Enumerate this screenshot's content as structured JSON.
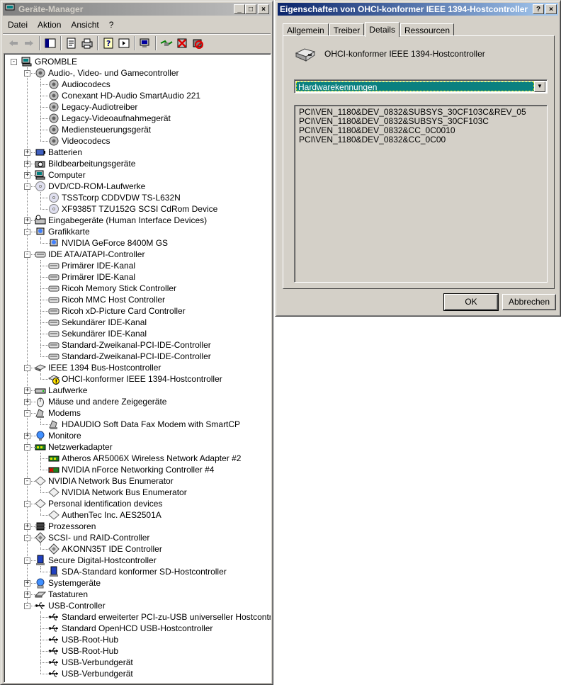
{
  "device_manager": {
    "title": "Geräte-Manager",
    "menu": [
      "Datei",
      "Aktion",
      "Ansicht",
      "?"
    ],
    "toolbar_icons": [
      "back-arrow-icon",
      "forward-arrow-icon",
      "console-tree-icon",
      "properties-icon",
      "print-icon",
      "help-icon",
      "view-icon",
      "scan-hardware-icon",
      "update-driver-icon",
      "uninstall-icon",
      "disable-icon"
    ],
    "tree": [
      {
        "label": "GROMBLE",
        "level": 0,
        "icon": "computer-icon",
        "exp": "-"
      },
      {
        "label": "Audio-, Video- und Gamecontroller",
        "level": 1,
        "icon": "audio-icon",
        "exp": "-"
      },
      {
        "label": "Audiocodecs",
        "level": 2,
        "icon": "audio-icon"
      },
      {
        "label": "Conexant HD-Audio SmartAudio 221",
        "level": 2,
        "icon": "audio-icon"
      },
      {
        "label": "Legacy-Audiotreiber",
        "level": 2,
        "icon": "audio-icon"
      },
      {
        "label": "Legacy-Videoaufnahmegerät",
        "level": 2,
        "icon": "audio-icon"
      },
      {
        "label": "Mediensteuerungsgerät",
        "level": 2,
        "icon": "audio-icon"
      },
      {
        "label": "Videocodecs",
        "level": 2,
        "icon": "audio-icon"
      },
      {
        "label": "Batterien",
        "level": 1,
        "icon": "battery-icon",
        "exp": "+"
      },
      {
        "label": "Bildbearbeitungsgeräte",
        "level": 1,
        "icon": "camera-icon",
        "exp": "+"
      },
      {
        "label": "Computer",
        "level": 1,
        "icon": "computer-icon",
        "exp": "+"
      },
      {
        "label": "DVD/CD-ROM-Laufwerke",
        "level": 1,
        "icon": "cd-icon",
        "exp": "-"
      },
      {
        "label": "TSSTcorp CDDVDW TS-L632N",
        "level": 2,
        "icon": "cd-icon"
      },
      {
        "label": "XF9385T TZU152G SCSI CdRom Device",
        "level": 2,
        "icon": "cd-icon"
      },
      {
        "label": "Eingabegeräte (Human Interface Devices)",
        "level": 1,
        "icon": "hid-icon",
        "exp": "+"
      },
      {
        "label": "Grafikkarte",
        "level": 1,
        "icon": "display-icon",
        "exp": "-"
      },
      {
        "label": "NVIDIA GeForce 8400M GS",
        "level": 2,
        "icon": "display-icon"
      },
      {
        "label": "IDE ATA/ATAPI-Controller",
        "level": 1,
        "icon": "ide-icon",
        "exp": "-"
      },
      {
        "label": "Primärer IDE-Kanal",
        "level": 2,
        "icon": "ide-icon"
      },
      {
        "label": "Primärer IDE-Kanal",
        "level": 2,
        "icon": "ide-icon"
      },
      {
        "label": "Ricoh Memory Stick Controller",
        "level": 2,
        "icon": "ide-icon"
      },
      {
        "label": "Ricoh MMC Host Controller",
        "level": 2,
        "icon": "ide-icon"
      },
      {
        "label": "Ricoh xD-Picture Card Controller",
        "level": 2,
        "icon": "ide-icon"
      },
      {
        "label": "Sekundärer IDE-Kanal",
        "level": 2,
        "icon": "ide-icon"
      },
      {
        "label": "Sekundärer IDE-Kanal",
        "level": 2,
        "icon": "ide-icon"
      },
      {
        "label": "Standard-Zweikanal-PCI-IDE-Controller",
        "level": 2,
        "icon": "ide-icon"
      },
      {
        "label": "Standard-Zweikanal-PCI-IDE-Controller",
        "level": 2,
        "icon": "ide-icon"
      },
      {
        "label": "IEEE 1394 Bus-Hostcontroller",
        "level": 1,
        "icon": "firewire-icon",
        "exp": "-"
      },
      {
        "label": "OHCI-konformer IEEE 1394-Hostcontroller",
        "level": 2,
        "icon": "warning-device-icon"
      },
      {
        "label": "Laufwerke",
        "level": 1,
        "icon": "drive-icon",
        "exp": "+"
      },
      {
        "label": "Mäuse und andere Zeigegeräte",
        "level": 1,
        "icon": "mouse-icon",
        "exp": "+"
      },
      {
        "label": "Modems",
        "level": 1,
        "icon": "modem-icon",
        "exp": "-"
      },
      {
        "label": "HDAUDIO Soft Data Fax Modem with SmartCP",
        "level": 2,
        "icon": "modem-icon"
      },
      {
        "label": "Monitore",
        "level": 1,
        "icon": "monitor-icon",
        "exp": "+"
      },
      {
        "label": "Netzwerkadapter",
        "level": 1,
        "icon": "network-icon",
        "exp": "-"
      },
      {
        "label": "Atheros AR5006X Wireless Network Adapter #2",
        "level": 2,
        "icon": "network-icon"
      },
      {
        "label": "NVIDIA nForce Networking Controller #4",
        "level": 2,
        "icon": "network-disabled-icon"
      },
      {
        "label": "NVIDIA Network Bus Enumerator",
        "level": 1,
        "icon": "diamond-icon",
        "exp": "-"
      },
      {
        "label": "NVIDIA Network Bus Enumerator",
        "level": 2,
        "icon": "diamond-icon"
      },
      {
        "label": "Personal identification devices",
        "level": 1,
        "icon": "diamond-icon",
        "exp": "-"
      },
      {
        "label": "AuthenTec Inc. AES2501A",
        "level": 2,
        "icon": "diamond-icon"
      },
      {
        "label": "Prozessoren",
        "level": 1,
        "icon": "cpu-icon",
        "exp": "+"
      },
      {
        "label": "SCSI- und RAID-Controller",
        "level": 1,
        "icon": "scsi-icon",
        "exp": "-"
      },
      {
        "label": "AKONN35T IDE Controller",
        "level": 2,
        "icon": "scsi-icon"
      },
      {
        "label": "Secure Digital-Hostcontroller",
        "level": 1,
        "icon": "sd-icon",
        "exp": "-"
      },
      {
        "label": "SDA-Standard konformer SD-Hostcontroller",
        "level": 2,
        "icon": "sd-icon"
      },
      {
        "label": "Systemgeräte",
        "level": 1,
        "icon": "system-icon",
        "exp": "+"
      },
      {
        "label": "Tastaturen",
        "level": 1,
        "icon": "keyboard-icon",
        "exp": "+"
      },
      {
        "label": "USB-Controller",
        "level": 1,
        "icon": "usb-icon",
        "exp": "-"
      },
      {
        "label": "Standard erweiterter PCI-zu-USB universeller Hostcontroller",
        "level": 2,
        "icon": "usb-icon"
      },
      {
        "label": "Standard OpenHCD USB-Hostcontroller",
        "level": 2,
        "icon": "usb-icon"
      },
      {
        "label": "USB-Root-Hub",
        "level": 2,
        "icon": "usb-icon"
      },
      {
        "label": "USB-Root-Hub",
        "level": 2,
        "icon": "usb-icon"
      },
      {
        "label": "USB-Verbundgerät",
        "level": 2,
        "icon": "usb-icon"
      },
      {
        "label": "USB-Verbundgerät",
        "level": 2,
        "icon": "usb-icon"
      }
    ]
  },
  "properties": {
    "title": "Eigenschaften von OHCI-konformer IEEE 1394-Hostcontroller",
    "tabs": [
      "Allgemein",
      "Treiber",
      "Details",
      "Ressourcen"
    ],
    "selected_tab": "Details",
    "device_name": "OHCI-konformer IEEE 1394-Hostcontroller",
    "property_select": "Hardwarekennungen",
    "values": [
      "PCI\\VEN_1180&DEV_0832&SUBSYS_30CF103C&REV_05",
      "PCI\\VEN_1180&DEV_0832&SUBSYS_30CF103C",
      "PCI\\VEN_1180&DEV_0832&CC_0C0010",
      "PCI\\VEN_1180&DEV_0832&CC_0C00"
    ],
    "ok_label": "OK",
    "cancel_label": "Abbrechen"
  },
  "colors": {
    "face": "#d4d0c8",
    "active_title": "#0a246a",
    "inactive_title": "#808080",
    "selection": "#0a8080"
  }
}
